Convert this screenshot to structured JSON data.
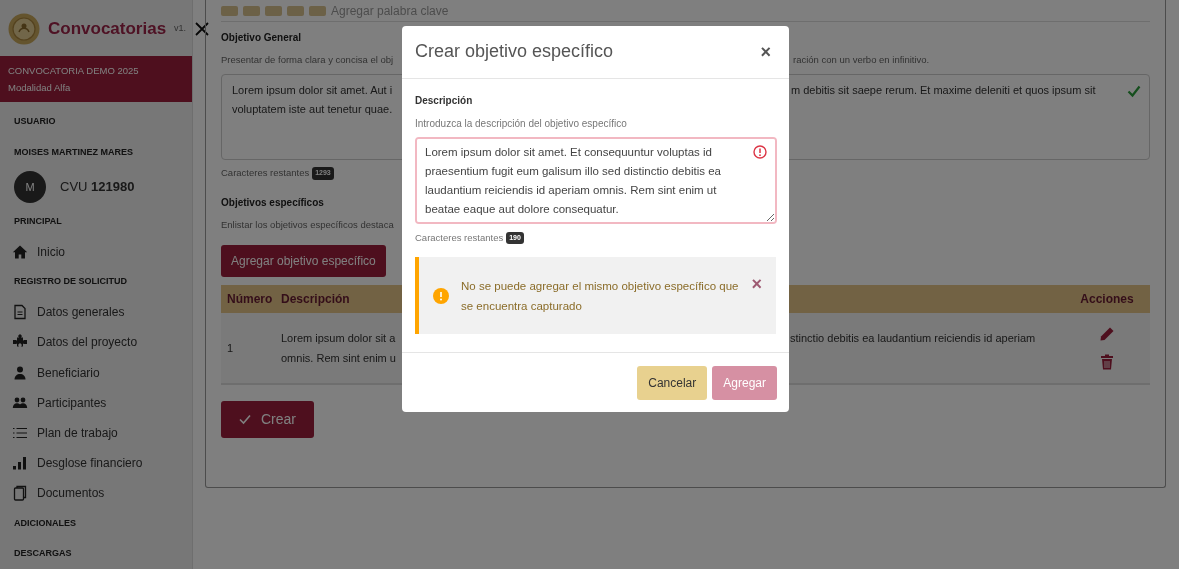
{
  "sidebar": {
    "title": "Convocatorias",
    "version": "v1.",
    "banner": [
      "CONVOCATORIA DEMO 2025",
      "Modalidad Alfa"
    ],
    "nav": [
      {
        "kind": "heading",
        "label": "USUARIO"
      },
      {
        "kind": "heading",
        "label": "MOISES MARTINEZ MARES"
      },
      {
        "kind": "user",
        "initial": "M",
        "label": "CVU",
        "number": "121980"
      },
      {
        "kind": "heading",
        "label": "PRINCIPAL"
      },
      {
        "kind": "home",
        "label": "Inicio"
      },
      {
        "kind": "heading",
        "label": "REGISTRO DE SOLICITUD"
      },
      {
        "kind": "file",
        "label": "Datos generales"
      },
      {
        "kind": "puzzle",
        "label": "Datos del proyecto"
      },
      {
        "kind": "person",
        "label": "Beneficiario"
      },
      {
        "kind": "people",
        "label": "Participantes"
      },
      {
        "kind": "list",
        "label": "Plan de trabajo"
      },
      {
        "kind": "chart",
        "label": "Desglose financiero"
      },
      {
        "kind": "copy",
        "label": "Documentos"
      },
      {
        "kind": "heading",
        "label": "ADICIONALES"
      },
      {
        "kind": "heading",
        "label": "DESCARGAS"
      }
    ]
  },
  "keywords": {
    "placeholder": "Agregar palabra clave"
  },
  "objetivo_general": {
    "label": "Objetivo General",
    "hint_left": "Presentar de forma clara y concisa el obj",
    "hint_right": "ración con un verbo en infinitivo.",
    "text_left": [
      "Lorem ipsum dolor sit amet. Aut i",
      "voluptatem iste aut tenetur quae."
    ],
    "text_right": [
      "m debitis sit saepe rerum. Et maxime deleniti et quos ipsum sit"
    ],
    "valid": true,
    "counter_label": "Caracteres restantes",
    "counter": "1293"
  },
  "objetivos_especificos": {
    "label": "Objetivos específicos",
    "hint_left": "Enlistar los objetivos específicos destaca",
    "add_button": "Agregar objetivo específico",
    "columns": [
      "Número",
      "Descripción",
      "Acciones"
    ],
    "rows": [
      {
        "number": "1",
        "text_left": [
          "Lorem ipsum dolor sit a",
          "omnis. Rem sint enim u"
        ],
        "text_right": [
          "stinctio debitis ea laudantium reiciendis id aperiam"
        ]
      }
    ]
  },
  "create_button": "Crear",
  "modal": {
    "title": "Crear objetivo específico",
    "close": "×",
    "field": {
      "label": "Descripción",
      "hint": "Introduzca la descripción del objetivo específico",
      "value": "Lorem ipsum dolor sit amet. Et consequuntur voluptas id praesentium fugit eum galisum illo sed distinctio debitis ea laudantium reiciendis id aperiam omnis. Rem sint enim ut beatae eaque aut dolore consequatur.",
      "invalid": true
    },
    "counter_label": "Caracteres restantes",
    "counter": "190",
    "alert": {
      "message": "No se puede agregar el mismo objetivo específico que se encuentra capturado",
      "close": "×"
    },
    "buttons": [
      {
        "label": "Cancelar",
        "kind": "secondary",
        "disabled": false
      },
      {
        "label": "Agregar",
        "kind": "primary",
        "disabled": true
      }
    ]
  }
}
